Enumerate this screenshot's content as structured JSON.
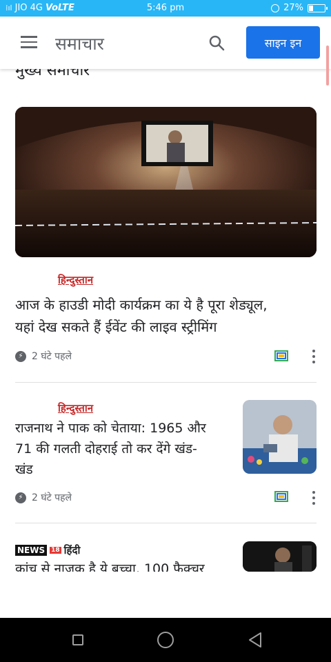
{
  "status_bar": {
    "carrier": "JIO 4G",
    "network_type": "VoLTE",
    "time": "5:46 pm",
    "battery_percent": "27%",
    "battery_level": 0.27
  },
  "app_bar": {
    "title": "समाचार",
    "signin_label": "साइन इन"
  },
  "partial_heading": "मुख्य समाचार",
  "articles": [
    {
      "source": "हिन्दुस्तान",
      "headline_line1": "आज के हाउडी मोदी कार्यक्रम का ये है पूरा शेड्यूल,",
      "headline_line2": "यहां देख सकते हैं ईवेंट की लाइव स्ट्रीमिंग",
      "time": "2 घंटे पहले"
    },
    {
      "source": "हिन्दुस्तान",
      "headline_line1": "राजनाथ ने पाक को चेताया: 1965 और",
      "headline_line2": "71 की गलती दोहराई तो कर देंगे खंड-",
      "headline_line3": "खंड",
      "time": "2 घंटे पहले"
    },
    {
      "source_box": "NEWS",
      "source_num": "18",
      "source_lang": "हिंदी",
      "headline_partial": "कांच से नाजुक है ये बच्चा, 100 फैक्चर"
    }
  ],
  "icons": {
    "menu": "menu-icon",
    "search": "search-icon",
    "time_bolt": "bolt-icon",
    "full_coverage": "full-coverage-icon",
    "more": "more-vert-icon"
  },
  "colors": {
    "status_bar": "#29b6f6",
    "accent": "#1a73e8",
    "hindustan_red": "#c62828",
    "coverage_green": "#34a853"
  }
}
